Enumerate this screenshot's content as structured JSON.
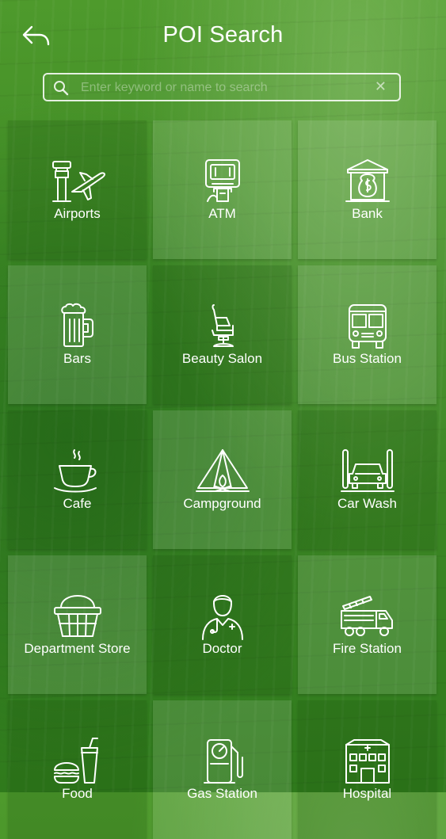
{
  "header": {
    "title": "POI Search",
    "back_icon": "back-arrow-icon"
  },
  "search": {
    "placeholder": "Enter keyword or name to search",
    "value": "",
    "clear_label": "✕"
  },
  "categories": [
    {
      "label": "Airports",
      "icon": "airport-icon"
    },
    {
      "label": "ATM",
      "icon": "atm-icon"
    },
    {
      "label": "Bank",
      "icon": "bank-icon"
    },
    {
      "label": "Bars",
      "icon": "beer-mug-icon"
    },
    {
      "label": "Beauty Salon",
      "icon": "salon-chair-icon"
    },
    {
      "label": "Bus Station",
      "icon": "bus-icon"
    },
    {
      "label": "Cafe",
      "icon": "coffee-cup-icon"
    },
    {
      "label": "Campground",
      "icon": "tent-icon"
    },
    {
      "label": "Car Wash",
      "icon": "car-wash-icon"
    },
    {
      "label": "Department Store",
      "icon": "basket-icon"
    },
    {
      "label": "Doctor",
      "icon": "doctor-icon"
    },
    {
      "label": "Fire Station",
      "icon": "fire-truck-icon"
    },
    {
      "label": "Food",
      "icon": "fast-food-icon"
    },
    {
      "label": "Gas Station",
      "icon": "gas-pump-icon"
    },
    {
      "label": "Hospital",
      "icon": "hospital-icon"
    }
  ]
}
